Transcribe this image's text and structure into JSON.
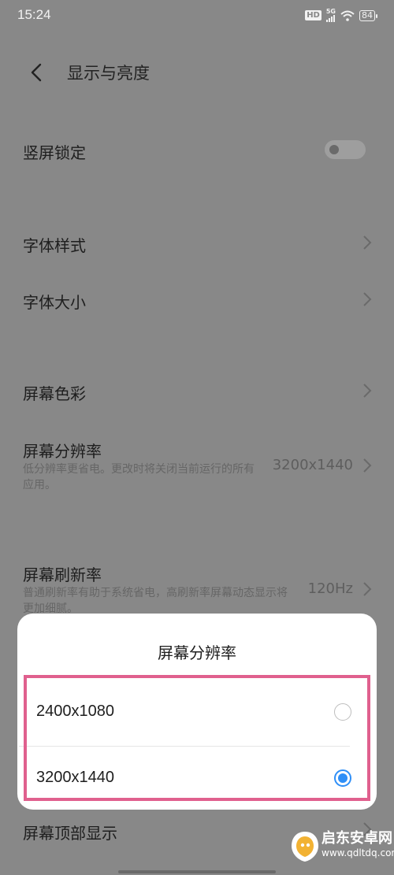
{
  "status_bar": {
    "time": "15:24",
    "hd_badge": "HD",
    "network": "5G",
    "battery": "84",
    "icons": [
      "hd-icon",
      "signal-icon",
      "wifi-icon",
      "battery-icon"
    ]
  },
  "header": {
    "title": "显示与亮度",
    "back_icon": "chevron-left-icon"
  },
  "settings": [
    {
      "id": "portrait-lock",
      "label": "竖屏锁定",
      "control": "toggle",
      "toggle_on": false
    },
    {
      "id": "font-style",
      "label": "字体样式",
      "control": "chevron"
    },
    {
      "id": "font-size",
      "label": "字体大小",
      "control": "chevron"
    },
    {
      "id": "screen-color",
      "label": "屏幕色彩",
      "control": "chevron"
    },
    {
      "id": "screen-resolution",
      "label": "屏幕分辨率",
      "description": "低分辨率更省电。更改时将关闭当前运行的所有应用。",
      "value": "3200x1440",
      "control": "chevron"
    },
    {
      "id": "refresh-rate",
      "label": "屏幕刷新率",
      "description": "普通刷新率有助于系统省电，高刷新率屏幕动态显示将更加细腻。",
      "value": "120Hz",
      "control": "chevron"
    },
    {
      "id": "top-display",
      "label": "屏幕顶部显示",
      "control": "chevron"
    }
  ],
  "dialog": {
    "title": "屏幕分辨率",
    "options": [
      {
        "label": "2400x1080",
        "selected": false
      },
      {
        "label": "3200x1440",
        "selected": true
      }
    ],
    "accent_color": "#2f8ff7",
    "highlight_color": "#e0608e"
  },
  "watermark": {
    "name": "启东安卓网",
    "url": "www.qdltdq.com"
  },
  "colors": {
    "overlay_background": "#888888",
    "dialog_background": "#ffffff"
  }
}
